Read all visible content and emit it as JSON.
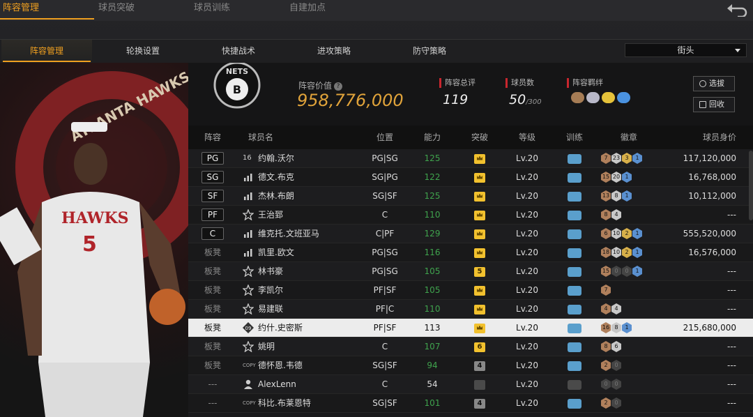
{
  "top_tabs": [
    "阵容管理",
    "球员突破",
    "球员训练",
    "自建加点"
  ],
  "sub_tabs": [
    "阵容管理",
    "轮换设置",
    "快捷战术",
    "进攻策略",
    "防守策略"
  ],
  "mode_select": {
    "value": "街头"
  },
  "team": {
    "value_label": "阵容价值",
    "value": "958,776,000",
    "rating_label": "阵容总评",
    "rating": "119",
    "count_label": "球员数",
    "count": "50",
    "count_max": "/300",
    "bond_label": "阵容羁绊",
    "select_label": "选拔",
    "recycle_label": "回收"
  },
  "columns": [
    "阵容",
    "球员名",
    "位置",
    "能力",
    "突破",
    "等级",
    "训练",
    "徽章",
    "球员身价"
  ],
  "players": [
    {
      "slot": "PG",
      "name": "约翰.沃尔",
      "pos": "PG|SG",
      "ability": "125",
      "break": "crown",
      "level": "Lv.20",
      "train": true,
      "badges": [
        {
          "t": "bronze",
          "v": "7"
        },
        {
          "t": "silver",
          "v": "23"
        },
        {
          "t": "gold",
          "v": "3"
        },
        {
          "t": "blue",
          "v": "1"
        }
      ],
      "value": "117,120,000",
      "icon": "16"
    },
    {
      "slot": "SG",
      "name": "德文.布克",
      "pos": "SG|PG",
      "ability": "122",
      "break": "crown",
      "level": "Lv.20",
      "train": true,
      "badges": [
        {
          "t": "bronze",
          "v": "15"
        },
        {
          "t": "silver",
          "v": "20"
        },
        {
          "t": "blue",
          "v": "1"
        }
      ],
      "value": "16,768,000",
      "icon": "bars"
    },
    {
      "slot": "SF",
      "name": "杰林.布朗",
      "pos": "SG|SF",
      "ability": "125",
      "break": "crown",
      "level": "Lv.20",
      "train": true,
      "badges": [
        {
          "t": "bronze",
          "v": "13"
        },
        {
          "t": "silver",
          "v": "8"
        },
        {
          "t": "blue",
          "v": "1"
        }
      ],
      "value": "10,112,000",
      "icon": "bars"
    },
    {
      "slot": "PF",
      "name": "王治郅",
      "pos": "C",
      "ability": "110",
      "break": "crown",
      "level": "Lv.20",
      "train": true,
      "badges": [
        {
          "t": "bronze",
          "v": "8"
        },
        {
          "t": "silver",
          "v": "4"
        }
      ],
      "value": "---",
      "icon": "star"
    },
    {
      "slot": "C",
      "name": "维克托.文班亚马",
      "pos": "C|PF",
      "ability": "129",
      "break": "crown",
      "level": "Lv.20",
      "train": true,
      "badges": [
        {
          "t": "bronze",
          "v": "6"
        },
        {
          "t": "silver",
          "v": "10"
        },
        {
          "t": "gold",
          "v": "2"
        },
        {
          "t": "blue",
          "v": "1"
        }
      ],
      "value": "555,520,000",
      "icon": "bars"
    },
    {
      "slot": "板凳",
      "name": "凯里.欧文",
      "pos": "PG|SG",
      "ability": "116",
      "break": "crown",
      "level": "Lv.20",
      "train": true,
      "badges": [
        {
          "t": "bronze",
          "v": "18"
        },
        {
          "t": "silver",
          "v": "10"
        },
        {
          "t": "gold",
          "v": "2"
        },
        {
          "t": "blue",
          "v": "1"
        }
      ],
      "value": "16,576,000",
      "icon": "bars"
    },
    {
      "slot": "板凳",
      "name": "林书豪",
      "pos": "PG|SG",
      "ability": "105",
      "break": "5",
      "level": "Lv.20",
      "train": true,
      "badges": [
        {
          "t": "bronze",
          "v": "15"
        },
        {
          "t": "dark",
          "v": "0"
        },
        {
          "t": "dark",
          "v": "0"
        },
        {
          "t": "blue",
          "v": "1"
        }
      ],
      "value": "---",
      "icon": "star"
    },
    {
      "slot": "板凳",
      "name": "李凯尔",
      "pos": "PF|SF",
      "ability": "105",
      "break": "crown",
      "level": "Lv.20",
      "train": true,
      "badges": [
        {
          "t": "bronze",
          "v": "7"
        }
      ],
      "value": "---",
      "icon": "star"
    },
    {
      "slot": "板凳",
      "name": "易建联",
      "pos": "PF|C",
      "ability": "110",
      "break": "crown",
      "level": "Lv.20",
      "train": true,
      "badges": [
        {
          "t": "bronze",
          "v": "4"
        },
        {
          "t": "silver",
          "v": "4"
        }
      ],
      "value": "---",
      "icon": "star"
    },
    {
      "slot": "板凳",
      "name": "约什.史密斯",
      "pos": "PF|SF",
      "ability": "113",
      "break": "crown",
      "level": "Lv.20",
      "train": true,
      "badges": [
        {
          "t": "bronze",
          "v": "16"
        },
        {
          "t": "silver",
          "v": "8"
        },
        {
          "t": "blue",
          "v": "1"
        }
      ],
      "value": "215,680,000",
      "icon": "09",
      "selected": true
    },
    {
      "slot": "板凳",
      "name": "姚明",
      "pos": "C",
      "ability": "107",
      "break": "6",
      "level": "Lv.20",
      "train": true,
      "badges": [
        {
          "t": "bronze",
          "v": "8"
        },
        {
          "t": "silver",
          "v": "6"
        }
      ],
      "value": "---",
      "icon": "star"
    },
    {
      "slot": "板凳",
      "name": "德怀恩.韦德",
      "pos": "SG|SF",
      "ability": "94",
      "break": "4",
      "level": "Lv.20",
      "train": true,
      "badges": [
        {
          "t": "bronze",
          "v": "2"
        },
        {
          "t": "dark",
          "v": "0"
        }
      ],
      "value": "---",
      "icon": "copy"
    },
    {
      "slot": "---",
      "name": "AlexLenn",
      "pos": "C",
      "ability": "54",
      "break": "none",
      "level": "Lv.20",
      "train": false,
      "badges": [
        {
          "t": "dark",
          "v": "0"
        },
        {
          "t": "dark",
          "v": "0"
        }
      ],
      "value": "---",
      "icon": "person"
    },
    {
      "slot": "---",
      "name": "科比.布莱恩特",
      "pos": "SG|SF",
      "ability": "101",
      "break": "4",
      "level": "Lv.20",
      "train": true,
      "badges": [
        {
          "t": "bronze",
          "v": "2"
        },
        {
          "t": "dark",
          "v": "0"
        }
      ],
      "value": "---",
      "icon": "copy"
    }
  ],
  "colors": {
    "accent": "#f0a020",
    "value_gold": "#e0a33a",
    "ability_green": "#3fa34d",
    "stat_red": "#c8262e"
  },
  "art": {
    "team_text": "ATLANTA HAWKS",
    "jersey": "HAWKS",
    "number": "5"
  },
  "logo": {
    "text": "NETS",
    "letter": "B"
  }
}
